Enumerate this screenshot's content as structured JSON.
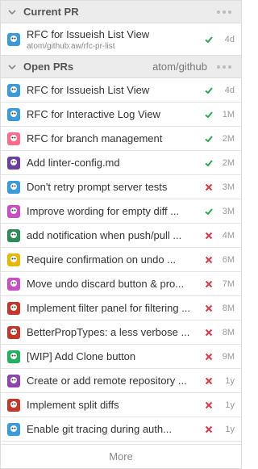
{
  "current_pr": {
    "header": "Current PR",
    "title": "RFC for Issueish List View",
    "branch": "atom/github:aw/rfc-pr-list",
    "status": "success",
    "age": "4d",
    "avatar_color": "#3b9ad9"
  },
  "open_prs": {
    "header": "Open PRs",
    "repo": "atom/github",
    "items": [
      {
        "title": "RFC for Issueish List View",
        "status": "success",
        "age": "4d",
        "avatar_color": "#3b9ad9"
      },
      {
        "title": "RFC for Interactive Log View",
        "status": "success",
        "age": "1M",
        "avatar_color": "#3b9ad9"
      },
      {
        "title": "RFC for branch management",
        "status": "success",
        "age": "2M",
        "avatar_color": "#ff6b8a"
      },
      {
        "title": "Add linter-config.md",
        "status": "success",
        "age": "2M",
        "avatar_color": "#6b3fa0"
      },
      {
        "title": "Don't retry prompt server tests",
        "status": "failure",
        "age": "3M",
        "avatar_color": "#3b9ad9"
      },
      {
        "title": "Improve wording for empty diff ...",
        "status": "success",
        "age": "3M",
        "avatar_color": "#c94fc4"
      },
      {
        "title": "add notification when push/pull ...",
        "status": "failure",
        "age": "4M",
        "avatar_color": "#2e8b57"
      },
      {
        "title": "Require confirmation on undo ...",
        "status": "failure",
        "age": "6M",
        "avatar_color": "#e6b800"
      },
      {
        "title": "Move undo discard button & pro...",
        "status": "failure",
        "age": "7M",
        "avatar_color": "#c94fc4"
      },
      {
        "title": "Implement filter panel for filtering ...",
        "status": "failure",
        "age": "8M",
        "avatar_color": "#c0392b"
      },
      {
        "title": "BetterPropTypes: a less verbose ...",
        "status": "failure",
        "age": "8M",
        "avatar_color": "#c0392b"
      },
      {
        "title": "[WIP] Add Clone button",
        "status": "failure",
        "age": "9M",
        "avatar_color": "#27ae60"
      },
      {
        "title": "Create or add remote repository ...",
        "status": "failure",
        "age": "1y",
        "avatar_color": "#8e44ad"
      },
      {
        "title": "Implement split diffs",
        "status": "failure",
        "age": "1y",
        "avatar_color": "#c0392b"
      },
      {
        "title": "Enable git tracing during auth...",
        "status": "failure",
        "age": "1y",
        "avatar_color": "#3b9ad9"
      }
    ]
  },
  "more_label": "More",
  "colors": {
    "success": "#2ea44f",
    "failure": "#d73a49"
  }
}
